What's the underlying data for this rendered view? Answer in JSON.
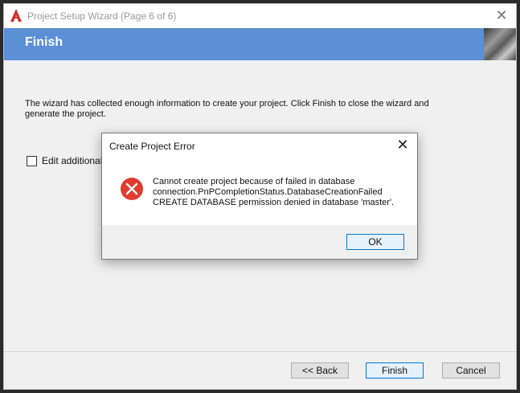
{
  "window": {
    "title": "Project Setup Wizard (Page 6 of 6)",
    "header_title": "Finish",
    "close_glyph": "✕",
    "app_icon": "autocad-app-icon",
    "colors": {
      "header_band": "#5b8fd6",
      "title_text": "#999999"
    }
  },
  "page": {
    "body_text": "The wizard has collected enough information to create your project. Click Finish to close the wizard and generate the project.",
    "checkbox_label": "Edit additional p",
    "checkbox_checked": false
  },
  "buttons": {
    "back": "<< Back",
    "finish": "Finish",
    "cancel": "Cancel"
  },
  "dialog": {
    "title": "Create Project Error",
    "close_glyph": "✕",
    "icon": "error-icon",
    "message_lines": [
      "Cannot create project because of failed in database",
      "connection.PnPCompletionStatus.DatabaseCreationFailed",
      "CREATE DATABASE permission denied in database 'master'."
    ],
    "ok_label": "OK",
    "colors": {
      "error_red": "#e03b2f"
    }
  }
}
